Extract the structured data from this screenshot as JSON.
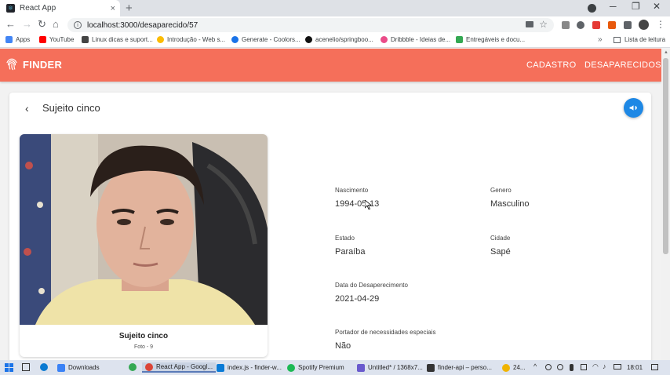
{
  "browser": {
    "tab_title": "React App",
    "tab_close": "×",
    "new_tab": "+",
    "url": "localhost:3000/desaparecido/57",
    "window_controls": {
      "minimize": "─",
      "restore": "❐",
      "close": "✕"
    },
    "bookmarks": [
      {
        "label": "Apps",
        "color": "#4285f4"
      },
      {
        "label": "YouTube",
        "color": "#ff0000"
      },
      {
        "label": "Linux dicas e suport...",
        "color": "#444444"
      },
      {
        "label": "Introdução - Web s...",
        "color": "#fbbc04"
      },
      {
        "label": "Generate - Coolors...",
        "color": "#1a73e8"
      },
      {
        "label": "acenelio/springboo...",
        "color": "#111111"
      },
      {
        "label": "Dribbble - Ideias de...",
        "color": "#ea4c89"
      },
      {
        "label": "Entregáveis e docu...",
        "color": "#34a853"
      }
    ],
    "bookmarks_more": "»",
    "reading_list": "Lista de leitura"
  },
  "app": {
    "brand": "FINDER",
    "nav": [
      "CADASTRO",
      "DESAPARECIDOS"
    ],
    "accent": "#f56f5a",
    "fab_color": "#1e88e5"
  },
  "person": {
    "title": "Sujeito cinco",
    "photo_caption": "Sujeito cinco",
    "photo_sub": "Foto - 9",
    "fields": {
      "nascimento": {
        "label": "Nascimento",
        "value": "1994-05-13"
      },
      "genero": {
        "label": "Genero",
        "value": "Masculino"
      },
      "estado": {
        "label": "Estado",
        "value": "Paraíba"
      },
      "cidade": {
        "label": "Cidade",
        "value": "Sapé"
      },
      "data": {
        "label": "Data do Desaperecimento",
        "value": "2021-04-29"
      },
      "portador": {
        "label": "Portador de necessidades especiais",
        "value": "Não"
      }
    }
  },
  "taskbar": {
    "items": [
      {
        "label": "Downloads",
        "color": "#3b82f6"
      },
      {
        "label": "React App - Googl...",
        "color": "#db4437"
      },
      {
        "label": "index.js - finder-w...",
        "color": "#0a7bd6"
      },
      {
        "label": "Spotify Premium",
        "color": "#1db954"
      },
      {
        "label": "Untitled* / 1368x7...",
        "color": "#6a5acd"
      },
      {
        "label": "finder-api – perso...",
        "color": "#333333"
      }
    ],
    "weather": "24...",
    "clock": "18:01"
  }
}
